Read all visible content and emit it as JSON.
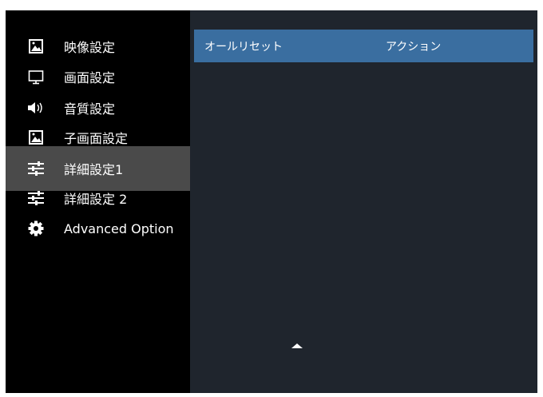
{
  "sidebar": {
    "items": [
      {
        "label": "映像設定",
        "icon": "picture-icon"
      },
      {
        "label": "画面設定",
        "icon": "monitor-icon"
      },
      {
        "label": "音質設定",
        "icon": "speaker-icon"
      },
      {
        "label": "子画面設定",
        "icon": "picture-icon"
      },
      {
        "label": "詳細設定1",
        "icon": "sliders-icon",
        "selected": true
      },
      {
        "label": "詳細設定 2",
        "icon": "sliders-icon"
      },
      {
        "label": "Advanced Option",
        "icon": "gear-icon"
      }
    ]
  },
  "panel": {
    "row": {
      "name": "オールリセット",
      "value": "アクション"
    }
  },
  "colors": {
    "background": "#000000",
    "panel": "#1f252d",
    "selected_row": "#3a6ea0",
    "selected_nav": "#4a4a4a"
  }
}
